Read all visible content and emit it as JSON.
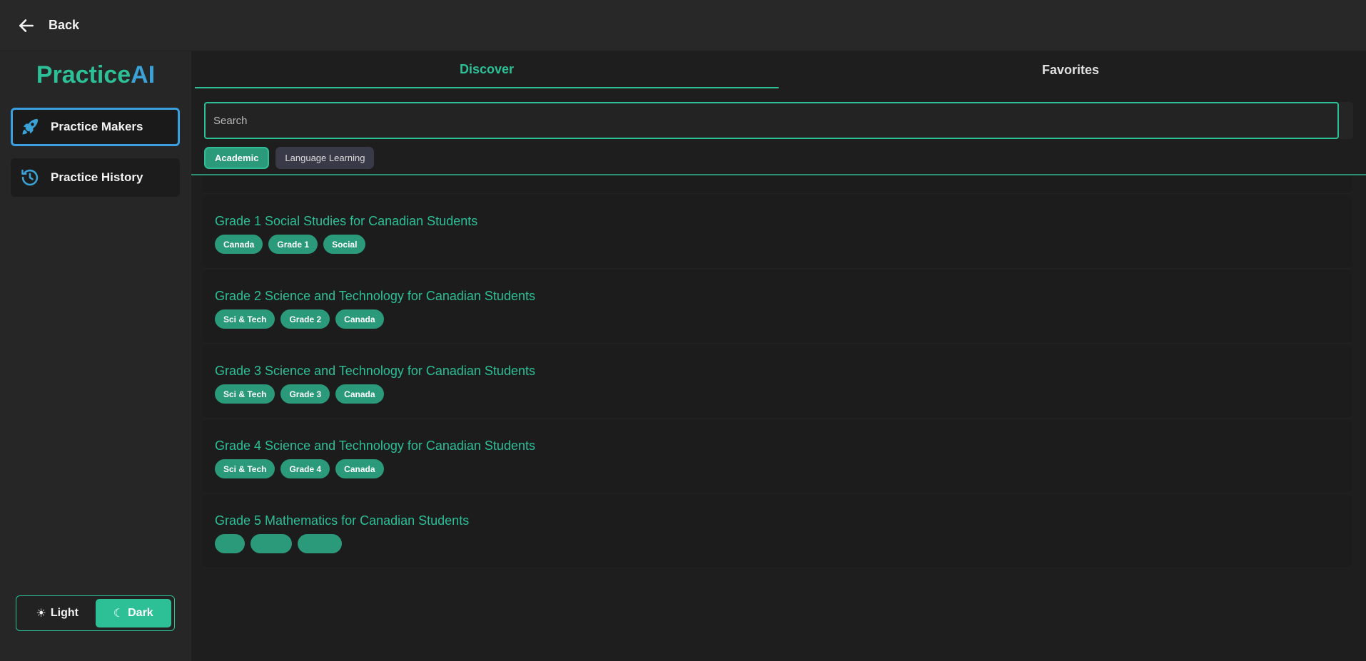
{
  "topbar": {
    "back_label": "Back"
  },
  "sidebar": {
    "brand_main": "Practice",
    "brand_ai": "AI",
    "items": [
      {
        "label": "Practice Makers",
        "icon": "rocket-icon",
        "active": true
      },
      {
        "label": "Practice History",
        "icon": "history-icon",
        "active": false
      }
    ],
    "theme": {
      "light_label": "Light",
      "dark_label": "Dark",
      "selected": "Dark"
    }
  },
  "main": {
    "tabs": [
      {
        "label": "Discover",
        "active": true
      },
      {
        "label": "Favorites",
        "active": false
      }
    ],
    "search": {
      "placeholder": "Search",
      "value": ""
    },
    "filters": [
      {
        "label": "Academic",
        "active": true
      },
      {
        "label": "Language Learning",
        "active": false
      }
    ],
    "cards": [
      {
        "title": "Grade 1 Social Studies for Canadian Students",
        "tags": [
          "Canada",
          "Grade 1",
          "Social"
        ]
      },
      {
        "title": "Grade 2 Science and Technology for Canadian Students",
        "tags": [
          "Sci & Tech",
          "Grade 2",
          "Canada"
        ]
      },
      {
        "title": "Grade 3 Science and Technology for Canadian Students",
        "tags": [
          "Sci & Tech",
          "Grade 3",
          "Canada"
        ]
      },
      {
        "title": "Grade 4 Science and Technology for Canadian Students",
        "tags": [
          "Sci & Tech",
          "Grade 4",
          "Canada"
        ]
      },
      {
        "title": "Grade 5 Mathematics for Canadian Students",
        "tags": [
          "",
          "",
          ""
        ]
      }
    ]
  },
  "colors": {
    "accent": "#2dbf96",
    "brand_ai": "#3aa2d6",
    "active_outline": "#3b9ede",
    "background": "#1e1e1e"
  }
}
